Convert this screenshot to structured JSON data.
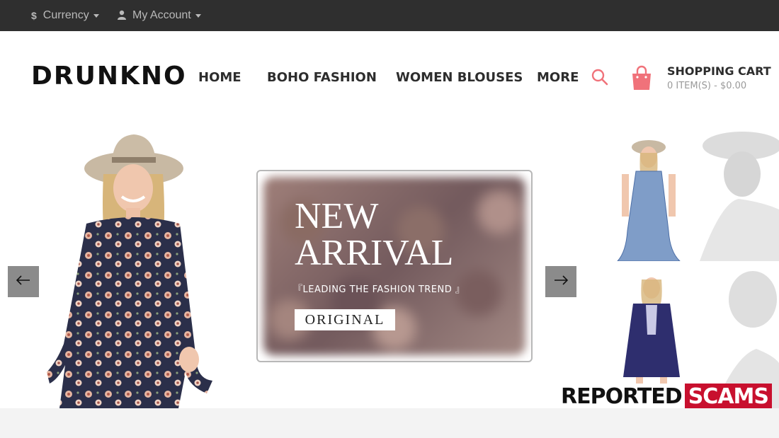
{
  "topbar": {
    "currency_icon": "$",
    "currency_label": "Currency",
    "account_icon": "user-icon",
    "account_label": "My Account"
  },
  "header": {
    "logo": "DRUNKNO",
    "nav": {
      "home": "HOME",
      "boho": "BOHO FASHION",
      "blouses": "WOMEN BLOUSES",
      "more": "MORE"
    },
    "cart_title": "SHOPPING CART",
    "cart_summary": "0 ITEM(S) - $0.00"
  },
  "hero": {
    "banner_line1": "NEW",
    "banner_line2": "ARRIVAL",
    "banner_tagline": "『LEADING THE FASHION TREND 』",
    "banner_button": "ORIGINAL",
    "prev_icon": "arrow-left-icon",
    "next_icon": "arrow-right-icon"
  },
  "watermark": {
    "left": "REPORTED",
    "right": "SCAMS"
  },
  "colors": {
    "topbar_bg": "#2f2f2f",
    "accent_pink": "#f0727a",
    "watermark_red": "#c8102e"
  }
}
